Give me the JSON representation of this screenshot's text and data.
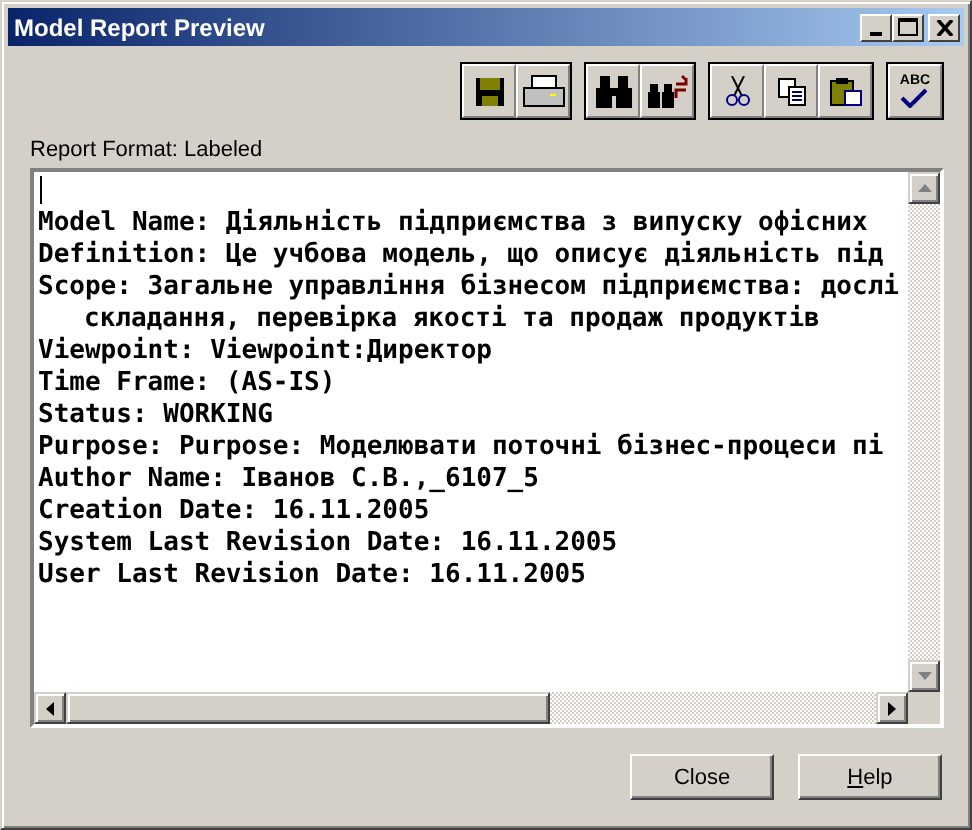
{
  "window": {
    "title": "Model Report Preview"
  },
  "title_buttons": [
    {
      "kind": "minimize"
    },
    {
      "kind": "maximize"
    },
    {
      "kind": "close"
    }
  ],
  "toolbar": [
    {
      "tools": [
        {
          "kind": "save"
        },
        {
          "kind": "print"
        }
      ]
    },
    {
      "tools": [
        {
          "kind": "find"
        },
        {
          "kind": "replace"
        }
      ]
    },
    {
      "tools": [
        {
          "kind": "cut"
        },
        {
          "kind": "copy"
        },
        {
          "kind": "paste"
        }
      ]
    },
    {
      "tools": [
        {
          "kind": "spell",
          "label": "ABC"
        }
      ]
    }
  ],
  "report_format_label": "Report Format: Labeled",
  "report": {
    "cursor": true,
    "lines": [
      {
        "text": "Model Name: Діяльність підприємства з випуску офісних",
        "continued": false
      },
      {
        "text": "Definition: Це учбова модель, що описує діяльність під",
        "continued": false
      },
      {
        "text": "Scope: Загальне управління бізнесом підприємства: дослі",
        "continued": false
      },
      {
        "text": "складання, перевірка якості та продаж продуктів",
        "continued": true
      },
      {
        "text": "Viewpoint: Viewpoint:Директор",
        "continued": false
      },
      {
        "text": "Time Frame: (AS-IS)",
        "continued": false
      },
      {
        "text": "Status: WORKING",
        "continued": false
      },
      {
        "text": "Purpose: Purpose: Моделювати поточні бізнес-процеси пі",
        "continued": false
      },
      {
        "text": "Author Name: Іванов С.В.,_6107_5",
        "continued": false
      },
      {
        "text": "Creation Date: 16.11.2005",
        "continued": false
      },
      {
        "text": "System Last Revision Date: 16.11.2005",
        "continued": false
      },
      {
        "text": "User Last Revision Date: 16.11.2005",
        "continued": false
      }
    ]
  },
  "buttons": [
    {
      "label": "Close",
      "underline_first": false
    },
    {
      "label": "Help",
      "underline_first": true
    }
  ]
}
